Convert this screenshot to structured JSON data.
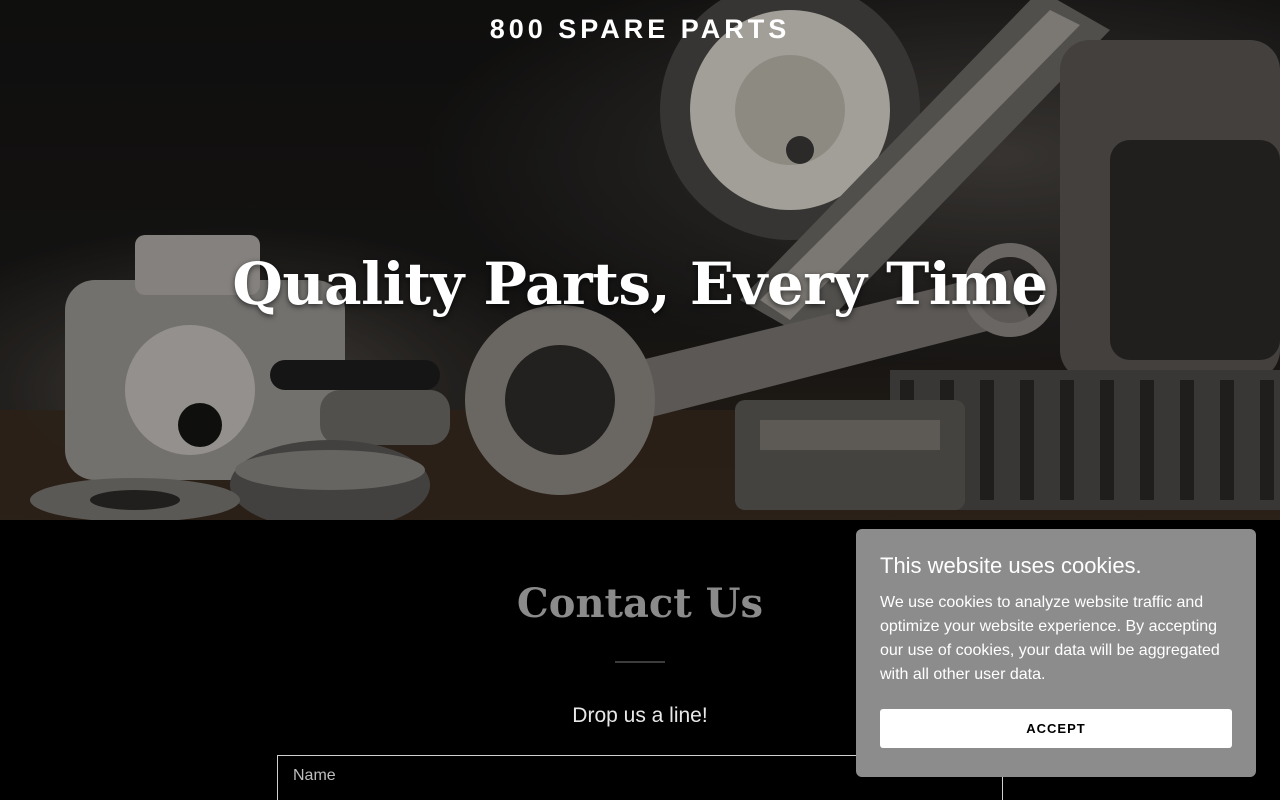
{
  "header": {
    "brand": "800 SPARE PARTS"
  },
  "hero": {
    "title": "Quality Parts, Every Time"
  },
  "contact": {
    "title": "Contact Us",
    "subtitle": "Drop us a line!",
    "name_placeholder": "Name"
  },
  "cookie_banner": {
    "title": "This website uses cookies.",
    "text": "We use cookies to analyze website traffic and optimize your website experience. By accepting our use of cookies, your data will be aggregated with all other user data.",
    "accept_label": "ACCEPT"
  },
  "colors": {
    "background": "#000000",
    "contact_title": "#8b8b8b",
    "cookie_bg": "#8c8c8c",
    "accept_bg": "#ffffff"
  }
}
